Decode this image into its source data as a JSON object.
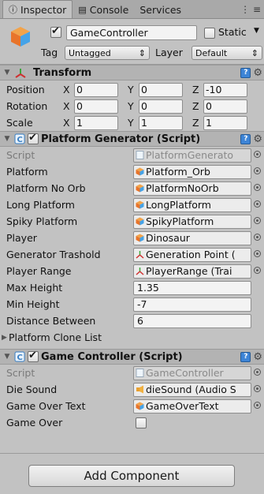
{
  "tabs": [
    {
      "label": "Inspector",
      "icon": "info-icon"
    },
    {
      "label": "Console",
      "icon": "console-icon"
    },
    {
      "label": "Services",
      "icon": ""
    }
  ],
  "tab_right": "⋮ ≡",
  "object": {
    "name": "GameController",
    "active": true,
    "static_label": "Static",
    "tag_label": "Tag",
    "tag_value": "Untagged",
    "layer_label": "Layer",
    "layer_value": "Default"
  },
  "transform": {
    "title": "Transform",
    "position_label": "Position",
    "rotation_label": "Rotation",
    "scale_label": "Scale",
    "position": {
      "x": "0",
      "y": "0",
      "z": "-10"
    },
    "rotation": {
      "x": "0",
      "y": "0",
      "z": "0"
    },
    "scale": {
      "x": "1",
      "y": "1",
      "z": "1"
    },
    "axes": {
      "x": "X",
      "y": "Y",
      "z": "Z"
    }
  },
  "platform_generator": {
    "title": "Platform Generator (Script)",
    "rows": [
      {
        "label": "Script",
        "value": "PlatformGenerato",
        "kind": "script"
      },
      {
        "label": "Platform",
        "value": "Platform_Orb",
        "kind": "prefab"
      },
      {
        "label": "Platform No Orb",
        "value": "PlatformNoOrb",
        "kind": "prefab"
      },
      {
        "label": "Long Platform",
        "value": "LongPlatform",
        "kind": "prefab"
      },
      {
        "label": "Spiky Platform",
        "value": "SpikyPlatform",
        "kind": "prefab"
      },
      {
        "label": "Player",
        "value": "Dinosaur",
        "kind": "prefab"
      },
      {
        "label": "Generator Trashold",
        "value": "Generation Point (",
        "kind": "transform"
      },
      {
        "label": "Player Range",
        "value": "PlayerRange (Trai",
        "kind": "transform"
      },
      {
        "label": "Max Height",
        "value": "1.35",
        "kind": "text"
      },
      {
        "label": "Min Height",
        "value": "-7",
        "kind": "text"
      },
      {
        "label": "Distance Between",
        "value": "6",
        "kind": "text"
      }
    ],
    "list_label": "Platform Clone List"
  },
  "game_controller": {
    "title": "Game Controller (Script)",
    "rows": [
      {
        "label": "Script",
        "value": "GameController",
        "kind": "script"
      },
      {
        "label": "Die Sound",
        "value": "dieSound (Audio S",
        "kind": "audio"
      },
      {
        "label": "Game Over Text",
        "value": "GameOverText",
        "kind": "prefab"
      }
    ],
    "game_over_label": "Game Over",
    "game_over_checked": false
  },
  "add_component_label": "Add Component"
}
